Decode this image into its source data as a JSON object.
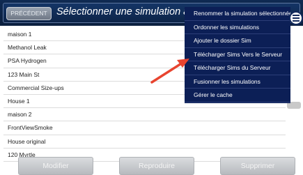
{
  "header": {
    "prev_label": "PRÉCÉDENT",
    "title": "Sélectionner une simulation à mo"
  },
  "simulations": [
    "maison 1",
    "Methanol Leak",
    "PSA Hydrogen",
    "123 Main St",
    "Commercial Size-ups",
    "House 1",
    "maison 2",
    "FrontViewSmoke",
    "House original",
    "120 Myrtle"
  ],
  "buttons": {
    "modify": "Modifier",
    "reproduce": "Reproduire",
    "delete": "Supprimer"
  },
  "menu": {
    "items": [
      "Renommer la simulation sélectionnée",
      "Ordonner les simulations",
      "Ajouter le dossier Sim",
      "Télécharger Sims Vers le Serveur",
      "Télécharger Sims du Serveur",
      "Fusionner les simulations",
      "Gérer le cache"
    ]
  },
  "colors": {
    "header": "#0f2a52",
    "menu_bg": "#0c1f56",
    "annotation_arrow": "#e8442f"
  },
  "icons": {
    "menu": "hamburger-menu-icon",
    "annotation": "red-arrow-annotation"
  }
}
